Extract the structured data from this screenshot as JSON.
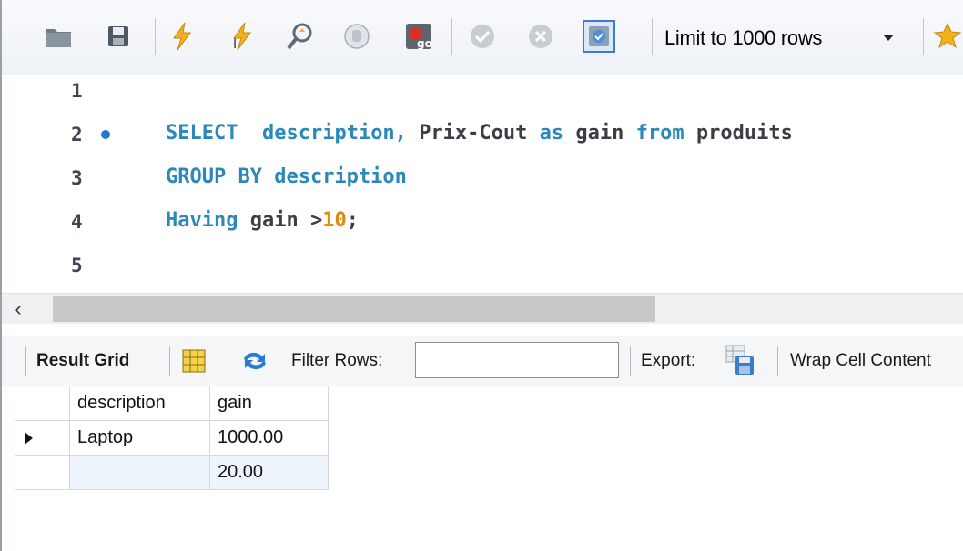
{
  "toolbar": {
    "limit_label": "Limit to 1000 rows"
  },
  "editor": {
    "lines": [
      {
        "number": "1"
      },
      {
        "number": "2"
      },
      {
        "number": "3"
      },
      {
        "number": "4"
      },
      {
        "number": "5"
      }
    ],
    "code": {
      "line2": {
        "kw_select": "SELECT",
        "cols": "description,",
        "expr": "Prix-Cout",
        "kw_as": "as",
        "alias": "gain",
        "kw_from": "from",
        "table": "produits"
      },
      "line3": {
        "kw_group": "GROUP BY description"
      },
      "line4": {
        "kw_having": "Having",
        "cond": "gain >",
        "value": "10",
        "end": ";"
      }
    }
  },
  "result_toolbar": {
    "result_grid_label": "Result Grid",
    "filter_label": "Filter Rows:",
    "filter_value": "",
    "export_label": "Export:",
    "wrap_label": "Wrap Cell Content"
  },
  "grid": {
    "columns": [
      "description",
      "gain"
    ],
    "rows": [
      [
        "Laptop",
        "1000.00"
      ],
      [
        "",
        "20.00"
      ]
    ]
  },
  "colors": {
    "keyword": "#2c88b8",
    "number": "#e08a10",
    "breakpoint_dot": "#1e7ad6",
    "alt_row": "#eef4fb"
  }
}
